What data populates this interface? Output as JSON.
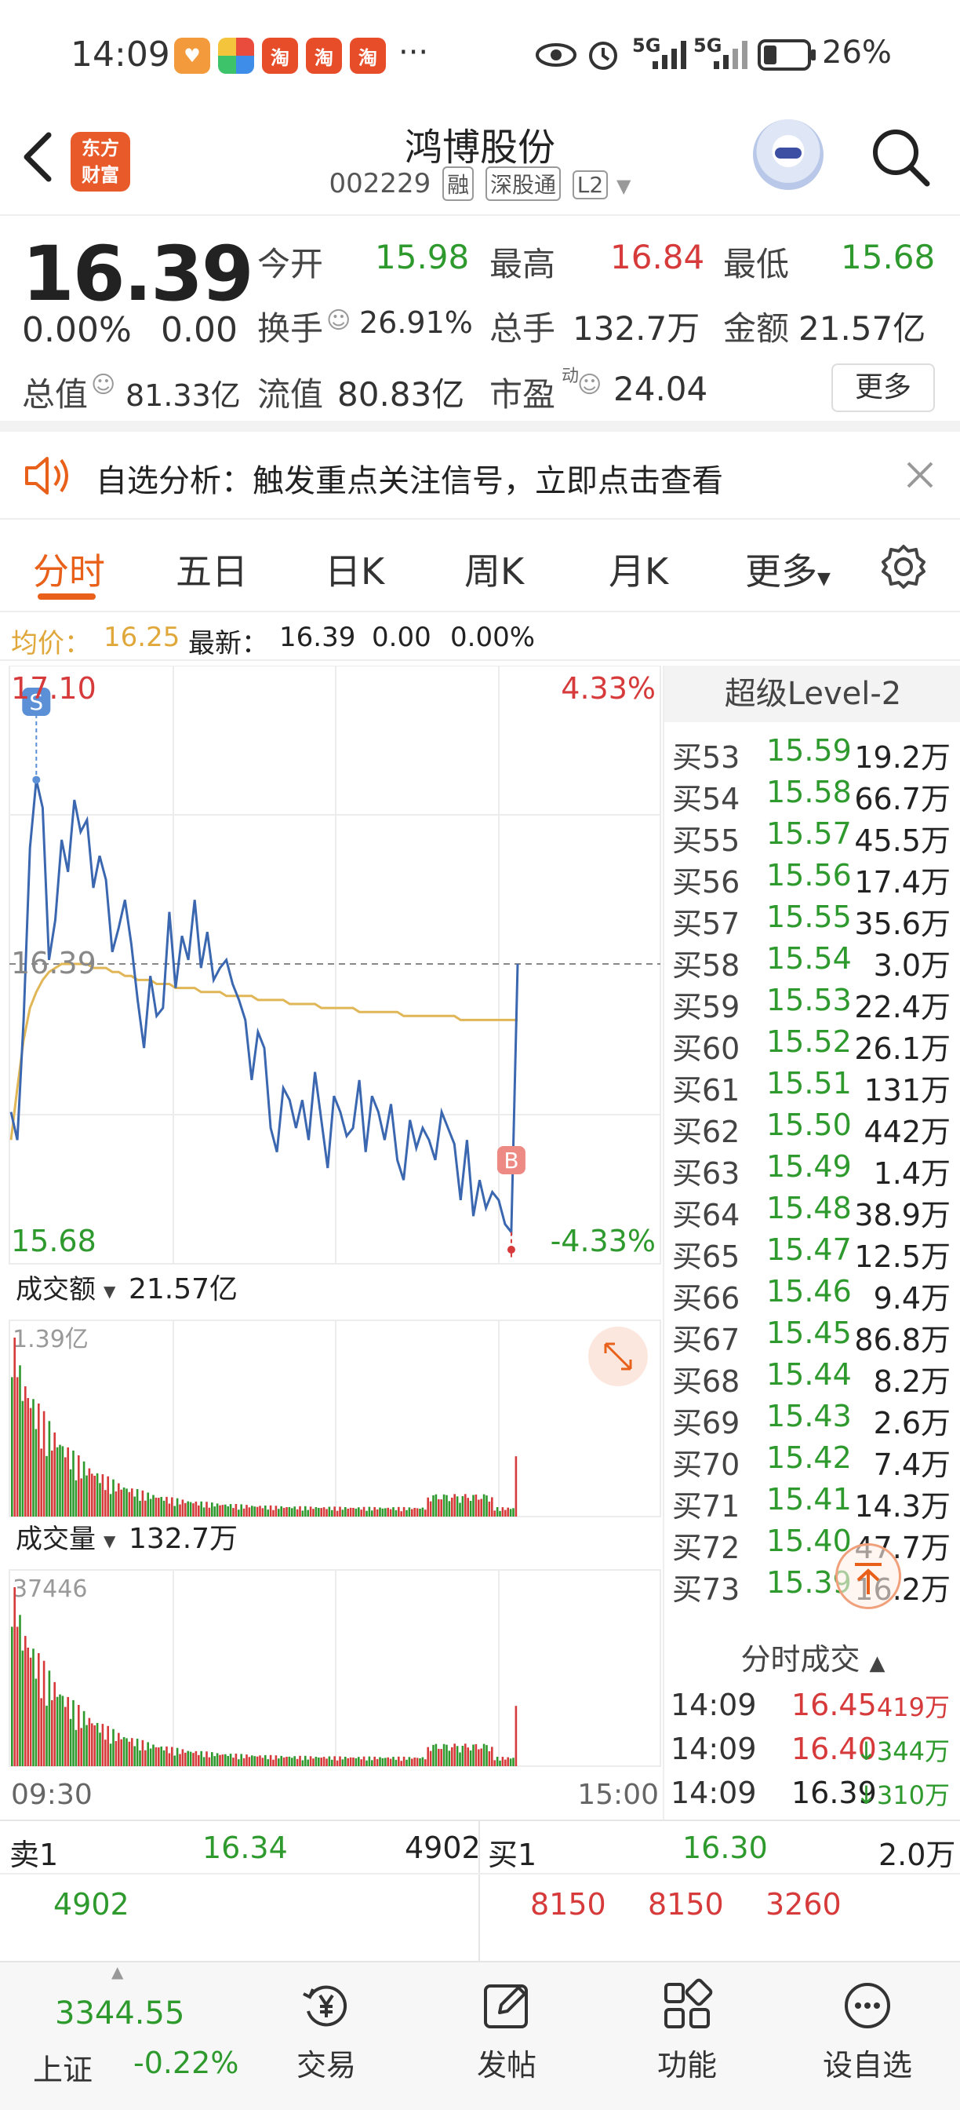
{
  "status_bar": {
    "time": "14:09",
    "more": "···",
    "network1": "5G",
    "network2": "5G",
    "battery": "26%"
  },
  "header": {
    "logo_text_1": "东方",
    "logo_text_2": "财富",
    "stock_name": "鸿博股份",
    "stock_code": "002229",
    "tags": [
      "融",
      "深股通",
      "L2"
    ]
  },
  "quote": {
    "price": "16.39",
    "change_pct": "0.00%",
    "change_amt": "0.00",
    "open_label": "今开",
    "open": "15.98",
    "high_label": "最高",
    "high": "16.84",
    "low_label": "最低",
    "low": "15.68",
    "turnover_label": "换手",
    "turnover": "26.91%",
    "volume_label": "总手",
    "volume": "132.7万",
    "amount_label": "金额",
    "amount": "21.57亿",
    "mcap_label": "总值",
    "mcap": "81.33亿",
    "float_label": "流值",
    "float": "80.83亿",
    "pe_label": "市盈",
    "pe_sup": "动",
    "pe": "24.04",
    "more_btn": "更多"
  },
  "alert": {
    "text": "自选分析：触发重点关注信号，立即点击查看"
  },
  "tabs": [
    "分时",
    "五日",
    "日K",
    "周K",
    "月K",
    "更多"
  ],
  "avg_line": {
    "avg_label": "均价：",
    "avg": "16.25",
    "latest_label": "最新：",
    "latest": "16.39",
    "chg": "0.00",
    "pct": "0.00%"
  },
  "chart_data": {
    "type": "line",
    "y_max_label": "17.10",
    "y_min_label": "15.68",
    "ref_label": "16.39",
    "pct_max_label": "4.33%",
    "pct_min_label": "-4.33%",
    "ylim": [
      15.68,
      17.1
    ],
    "ref_price": 16.39,
    "x_start": "09:30",
    "x_end": "15:00",
    "markers": {
      "sell": "S",
      "buy": "B"
    },
    "price_series": [
      16.02,
      15.95,
      16.25,
      16.68,
      16.85,
      16.78,
      16.4,
      16.5,
      16.7,
      16.62,
      16.8,
      16.72,
      16.75,
      16.58,
      16.66,
      16.6,
      16.42,
      16.48,
      16.55,
      16.44,
      16.3,
      16.18,
      16.36,
      16.26,
      16.28,
      16.52,
      16.33,
      16.46,
      16.4,
      16.55,
      16.38,
      16.47,
      16.35,
      16.38,
      16.4,
      16.34,
      16.3,
      16.25,
      16.1,
      16.22,
      16.18,
      15.98,
      15.92,
      16.08,
      16.05,
      15.98,
      16.05,
      15.95,
      16.12,
      16.0,
      15.88,
      16.06,
      16.02,
      15.96,
      15.98,
      16.1,
      15.92,
      16.06,
      16.02,
      15.95,
      16.04,
      15.9,
      15.85,
      16.0,
      15.93,
      15.98,
      15.95,
      15.9,
      16.02,
      15.98,
      15.94,
      15.8,
      15.95,
      15.76,
      15.85,
      15.78,
      15.82,
      15.8,
      15.74,
      15.72,
      16.39
    ],
    "avg_series": [
      15.95,
      16.08,
      16.2,
      16.28,
      16.32,
      16.35,
      16.37,
      16.38,
      16.39,
      16.39,
      16.39,
      16.39,
      16.39,
      16.38,
      16.38,
      16.38,
      16.37,
      16.37,
      16.36,
      16.36,
      16.35,
      16.35,
      16.35,
      16.34,
      16.34,
      16.34,
      16.33,
      16.33,
      16.33,
      16.33,
      16.32,
      16.32,
      16.32,
      16.32,
      16.31,
      16.31,
      16.31,
      16.31,
      16.31,
      16.3,
      16.3,
      16.3,
      16.3,
      16.3,
      16.29,
      16.29,
      16.29,
      16.29,
      16.29,
      16.28,
      16.28,
      16.28,
      16.28,
      16.28,
      16.28,
      16.27,
      16.27,
      16.27,
      16.27,
      16.27,
      16.27,
      16.27,
      16.26,
      16.26,
      16.26,
      16.26,
      16.26,
      16.26,
      16.26,
      16.26,
      16.26,
      16.25,
      16.25,
      16.25,
      16.25,
      16.25,
      16.25,
      16.25,
      16.25,
      16.25,
      16.25
    ]
  },
  "volume_panels": {
    "amount_label": "成交额",
    "amount_total": "21.57亿",
    "amount_max": "1.39亿",
    "vol_label": "成交量",
    "vol_total": "132.7万",
    "vol_max": "37446"
  },
  "level2": {
    "title": "超级Level-2",
    "rows": [
      {
        "label": "买53",
        "price": "15.59",
        "vol": "19.2万"
      },
      {
        "label": "买54",
        "price": "15.58",
        "vol": "66.7万"
      },
      {
        "label": "买55",
        "price": "15.57",
        "vol": "45.5万"
      },
      {
        "label": "买56",
        "price": "15.56",
        "vol": "17.4万"
      },
      {
        "label": "买57",
        "price": "15.55",
        "vol": "35.6万"
      },
      {
        "label": "买58",
        "price": "15.54",
        "vol": "3.0万"
      },
      {
        "label": "买59",
        "price": "15.53",
        "vol": "22.4万"
      },
      {
        "label": "买60",
        "price": "15.52",
        "vol": "26.1万"
      },
      {
        "label": "买61",
        "price": "15.51",
        "vol": "131万"
      },
      {
        "label": "买62",
        "price": "15.50",
        "vol": "442万"
      },
      {
        "label": "买63",
        "price": "15.49",
        "vol": "1.4万"
      },
      {
        "label": "买64",
        "price": "15.48",
        "vol": "38.9万"
      },
      {
        "label": "买65",
        "price": "15.47",
        "vol": "12.5万"
      },
      {
        "label": "买66",
        "price": "15.46",
        "vol": "9.4万"
      },
      {
        "label": "买67",
        "price": "15.45",
        "vol": "86.8万"
      },
      {
        "label": "买68",
        "price": "15.44",
        "vol": "8.2万"
      },
      {
        "label": "买69",
        "price": "15.43",
        "vol": "2.6万"
      },
      {
        "label": "买70",
        "price": "15.42",
        "vol": "7.4万"
      },
      {
        "label": "买71",
        "price": "15.41",
        "vol": "14.3万"
      },
      {
        "label": "买72",
        "price": "15.40",
        "vol": "47.7万"
      },
      {
        "label": "买73",
        "price": "15.39",
        "vol": "16.2万"
      }
    ],
    "trades_title": "分时成交",
    "trades": [
      {
        "time": "14:09",
        "price": "16.45",
        "vol": "419万",
        "color": "#d63a3a"
      },
      {
        "time": "14:09",
        "price": "16.40",
        "vol": "↓344万",
        "color": "#d63a3a"
      },
      {
        "time": "14:09",
        "price": "16.39",
        "vol": "↓310万",
        "color": "#222222"
      }
    ]
  },
  "bottom_quote": {
    "sell_label": "卖1",
    "sell_price": "16.34",
    "sell_vol": "4902",
    "buy_label": "买1",
    "buy_price": "16.30",
    "buy_vol": "2.0万",
    "row2_left": "4902",
    "row2_right": [
      "8150",
      "8150",
      "3260"
    ]
  },
  "bottom_nav": {
    "index_value": "3344.55",
    "index_name": "上证",
    "index_change": "-0.22%",
    "items": [
      "交易",
      "发帖",
      "功能",
      "设自选"
    ]
  },
  "colors": {
    "up": "#d63a3a",
    "down": "#2e9a2e",
    "accent": "#e8601a",
    "price_line": "#3a67b0",
    "avg_line": "#e0b656"
  }
}
